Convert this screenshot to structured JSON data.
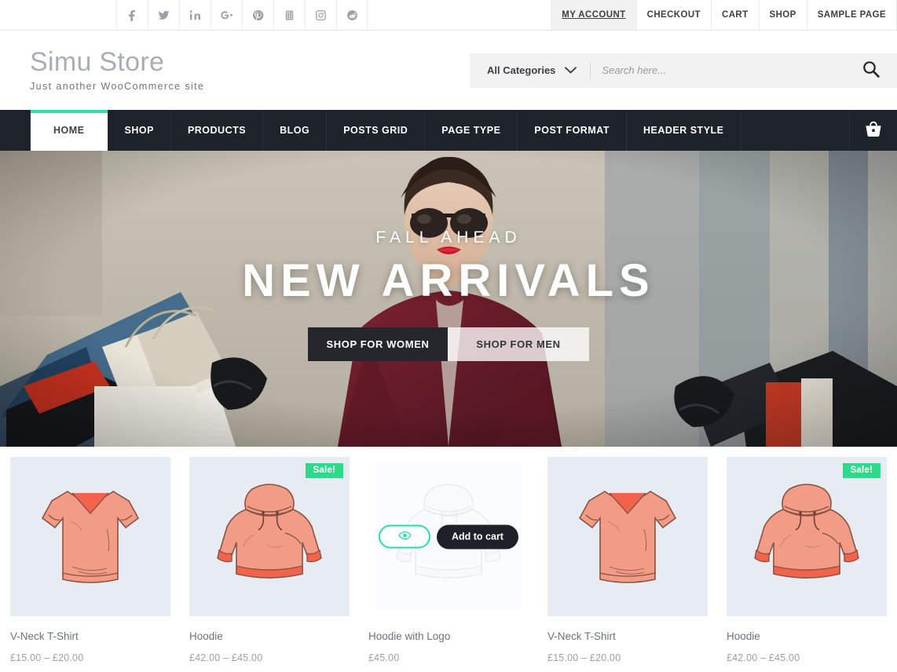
{
  "topbar": {
    "social": [
      {
        "name": "facebook-icon",
        "label": "Facebook"
      },
      {
        "name": "twitter-icon",
        "label": "Twitter"
      },
      {
        "name": "linkedin-icon",
        "label": "LinkedIn"
      },
      {
        "name": "google-plus-icon",
        "label": "Google Plus"
      },
      {
        "name": "pinterest-icon",
        "label": "Pinterest"
      },
      {
        "name": "youtube-icon",
        "label": "YouTube"
      },
      {
        "name": "instagram-icon",
        "label": "Instagram"
      },
      {
        "name": "reddit-icon",
        "label": "Reddit"
      }
    ],
    "nav": [
      {
        "label": "MY ACCOUNT",
        "active": true
      },
      {
        "label": "CHECKOUT",
        "active": false
      },
      {
        "label": "CART",
        "active": false
      },
      {
        "label": "SHOP",
        "active": false
      },
      {
        "label": "SAMPLE PAGE",
        "active": false
      }
    ]
  },
  "header": {
    "site_title": "Simu Store",
    "tagline": "Just another WooCommerce site",
    "search": {
      "category_label": "All Categories",
      "placeholder": "Search here...",
      "value": "",
      "button_icon": "search-icon"
    }
  },
  "mainnav": {
    "items": [
      {
        "label": "HOME",
        "active": true
      },
      {
        "label": "SHOP",
        "active": false
      },
      {
        "label": "PRODUCTS",
        "active": false
      },
      {
        "label": "BLOG",
        "active": false
      },
      {
        "label": "POSTS GRID",
        "active": false
      },
      {
        "label": "PAGE TYPE",
        "active": false
      },
      {
        "label": "POST FORMAT",
        "active": false
      },
      {
        "label": "HEADER STYLE",
        "active": false
      }
    ],
    "cart_icon": "shopping-basket-icon"
  },
  "hero": {
    "subtitle": "FALL AHEAD",
    "title": "NEW ARRIVALS",
    "button_primary": "SHOP FOR WOMEN",
    "button_secondary": "SHOP FOR MEN"
  },
  "products": [
    {
      "title": "V-Neck T-Shirt",
      "price": "£15.00 – £20.00",
      "image": "tshirt",
      "sale": false,
      "hovered": false
    },
    {
      "title": "Hoodie",
      "price": "£42.00 – £45.00",
      "image": "hoodie",
      "sale": true,
      "sale_label": "Sale!",
      "hovered": false
    },
    {
      "title": "Hoodie with Logo",
      "price": "£45.00",
      "image": "hoodie",
      "sale": false,
      "hovered": true,
      "quickview_label": "",
      "addcart_label": "Add to cart"
    },
    {
      "title": "V-Neck T-Shirt",
      "price": "£15.00 – £20.00",
      "image": "tshirt",
      "sale": false,
      "hovered": false
    },
    {
      "title": "Hoodie",
      "price": "£42.00 – £45.00",
      "image": "hoodie",
      "sale": true,
      "sale_label": "Sale!",
      "hovered": false
    }
  ],
  "colors": {
    "accent_teal": "#2ee0ac",
    "sale_green": "#2ed98a",
    "nav_dark": "#1e232b",
    "brand_gray": "#a9aeb4",
    "product_bg": "#e6ecf1"
  }
}
